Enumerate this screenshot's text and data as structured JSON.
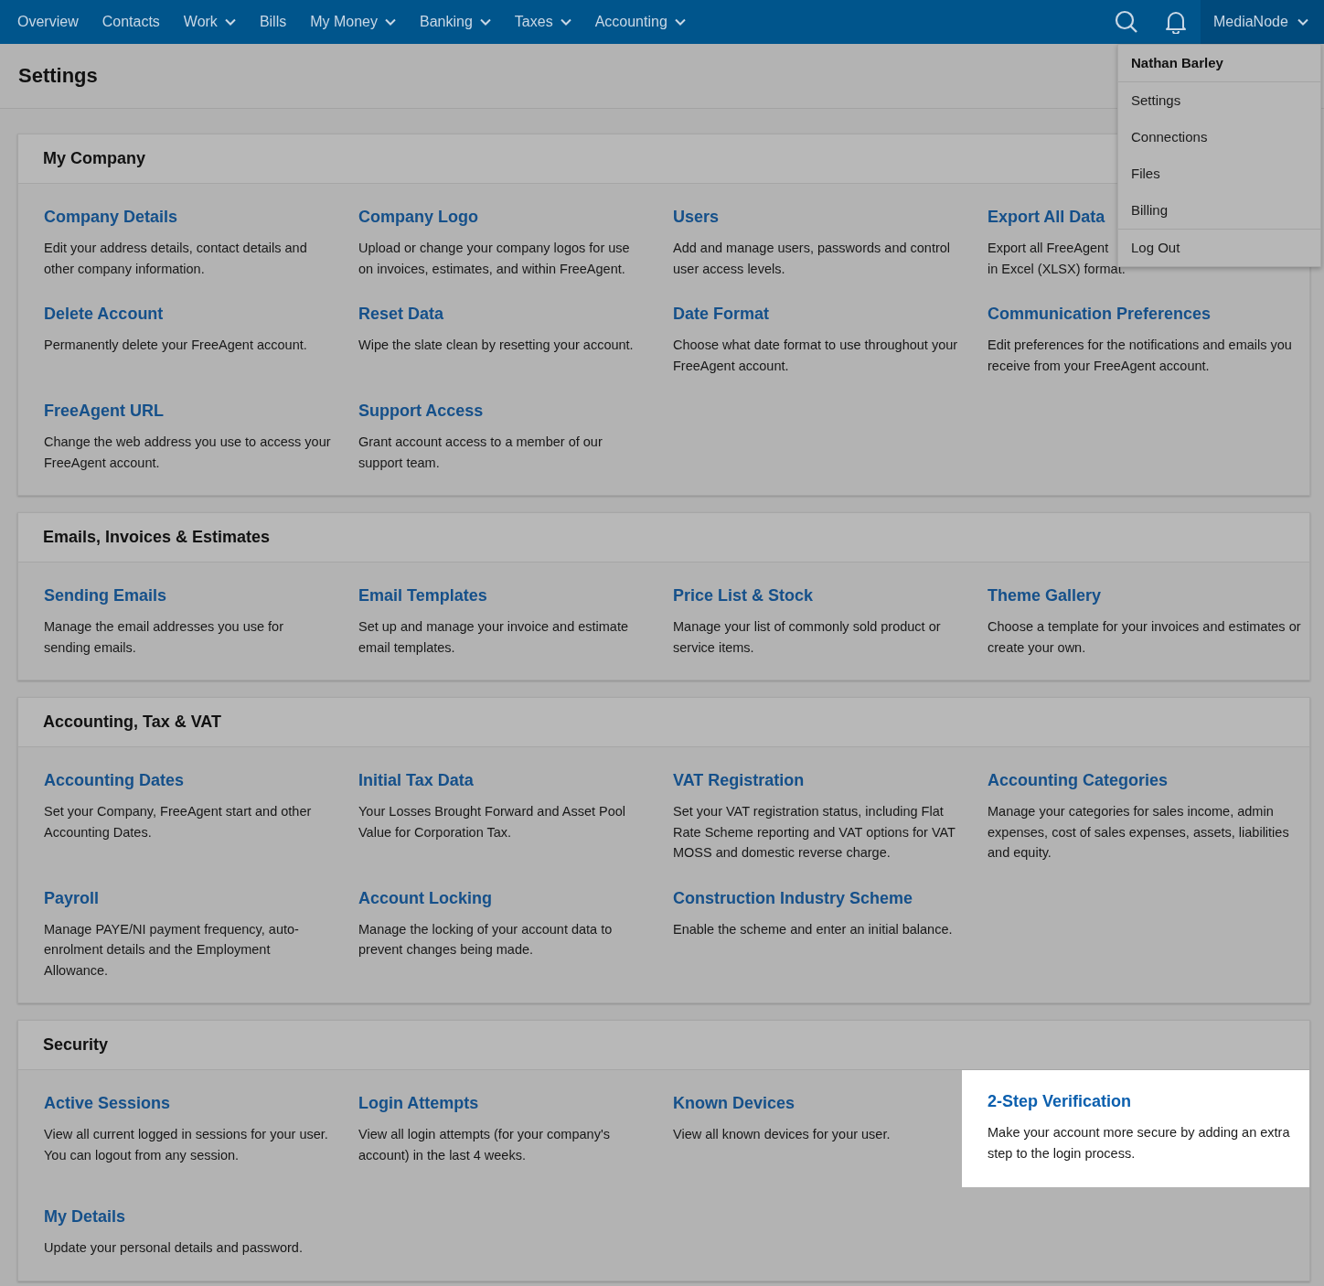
{
  "nav": {
    "items": [
      {
        "label": "Overview",
        "has_menu": false
      },
      {
        "label": "Contacts",
        "has_menu": false
      },
      {
        "label": "Work",
        "has_menu": true
      },
      {
        "label": "Bills",
        "has_menu": false
      },
      {
        "label": "My Money",
        "has_menu": true
      },
      {
        "label": "Banking",
        "has_menu": true
      },
      {
        "label": "Taxes",
        "has_menu": true
      },
      {
        "label": "Accounting",
        "has_menu": true
      }
    ],
    "account": {
      "label": "MediaNode",
      "expanded": true,
      "menu": {
        "header": "Nathan Barley",
        "groups": [
          [
            "Settings",
            "Connections",
            "Files",
            "Billing"
          ],
          [
            "Log Out"
          ]
        ]
      }
    }
  },
  "page_title": "Settings",
  "sections": [
    {
      "title": "My Company",
      "items": [
        {
          "title": "Company Details",
          "description": "Edit your address details, contact details and other company information.",
          "highlighted": false
        },
        {
          "title": "Company Logo",
          "description": "Upload or change your company logos for use on invoices, estimates, and within FreeAgent.",
          "highlighted": false
        },
        {
          "title": "Users",
          "description": "Add and manage users, passwords and control user access levels.",
          "highlighted": false
        },
        {
          "title": "Export All Data",
          "description": "Export all FreeAgent\nin Excel (XLSX) format.",
          "highlighted": false
        },
        {
          "title": "Delete Account",
          "description": "Permanently delete your FreeAgent account.",
          "highlighted": false
        },
        {
          "title": "Reset Data",
          "description": "Wipe the slate clean by resetting your account.",
          "highlighted": false
        },
        {
          "title": "Date Format",
          "description": "Choose what date format to use throughout your FreeAgent account.",
          "highlighted": false
        },
        {
          "title": "Communication Preferences",
          "description": "Edit preferences for the notifications and emails you receive from your FreeAgent account.",
          "highlighted": false
        },
        {
          "title": "FreeAgent URL",
          "description": "Change the web address you use to access your FreeAgent account.",
          "highlighted": false
        },
        {
          "title": "Support Access",
          "description": "Grant account access to a member of our support team.",
          "highlighted": false
        }
      ]
    },
    {
      "title": "Emails, Invoices & Estimates",
      "items": [
        {
          "title": "Sending Emails",
          "description": "Manage the email addresses you use for sending emails.",
          "highlighted": false
        },
        {
          "title": "Email Templates",
          "description": "Set up and manage your invoice and estimate email templates.",
          "highlighted": false
        },
        {
          "title": "Price List & Stock",
          "description": "Manage your list of commonly sold product or service items.",
          "highlighted": false
        },
        {
          "title": "Theme Gallery",
          "description": "Choose a template for your invoices and estimates or create your own.",
          "highlighted": false
        }
      ]
    },
    {
      "title": "Accounting, Tax & VAT",
      "items": [
        {
          "title": "Accounting Dates",
          "description": "Set your Company, FreeAgent start and other Accounting Dates.",
          "highlighted": false
        },
        {
          "title": "Initial Tax Data",
          "description": "Your Losses Brought Forward and Asset Pool Value for Corporation Tax.",
          "highlighted": false
        },
        {
          "title": "VAT Registration",
          "description": "Set your VAT registration status, including Flat Rate Scheme reporting and VAT options for VAT MOSS and domestic reverse charge.",
          "highlighted": false
        },
        {
          "title": "Accounting Categories",
          "description": "Manage your categories for sales income, admin expenses, cost of sales expenses, assets, liabilities and equity.",
          "highlighted": false
        },
        {
          "title": "Payroll",
          "description": "Manage PAYE/NI payment frequency, auto-enrolment details and the Employment Allowance.",
          "highlighted": false
        },
        {
          "title": "Account Locking",
          "description": "Manage the locking of your account data to prevent changes being made.",
          "highlighted": false
        },
        {
          "title": "Construction Industry Scheme",
          "description": "Enable the scheme and enter an initial balance.",
          "highlighted": false
        }
      ]
    },
    {
      "title": "Security",
      "items": [
        {
          "title": "Active Sessions",
          "description": "View all current logged in sessions for your user. You can logout from any session.",
          "highlighted": false
        },
        {
          "title": "Login Attempts",
          "description": "View all login attempts (for your company's account) in the last 4 weeks.",
          "highlighted": false
        },
        {
          "title": "Known Devices",
          "description": "View all known devices for your user.",
          "highlighted": false
        },
        {
          "title": "2-Step Verification",
          "description": "Make your account more secure by adding an extra step to the login process.",
          "highlighted": true
        },
        {
          "title": "My Details",
          "description": "Update your personal details and password.",
          "highlighted": false
        }
      ]
    }
  ]
}
